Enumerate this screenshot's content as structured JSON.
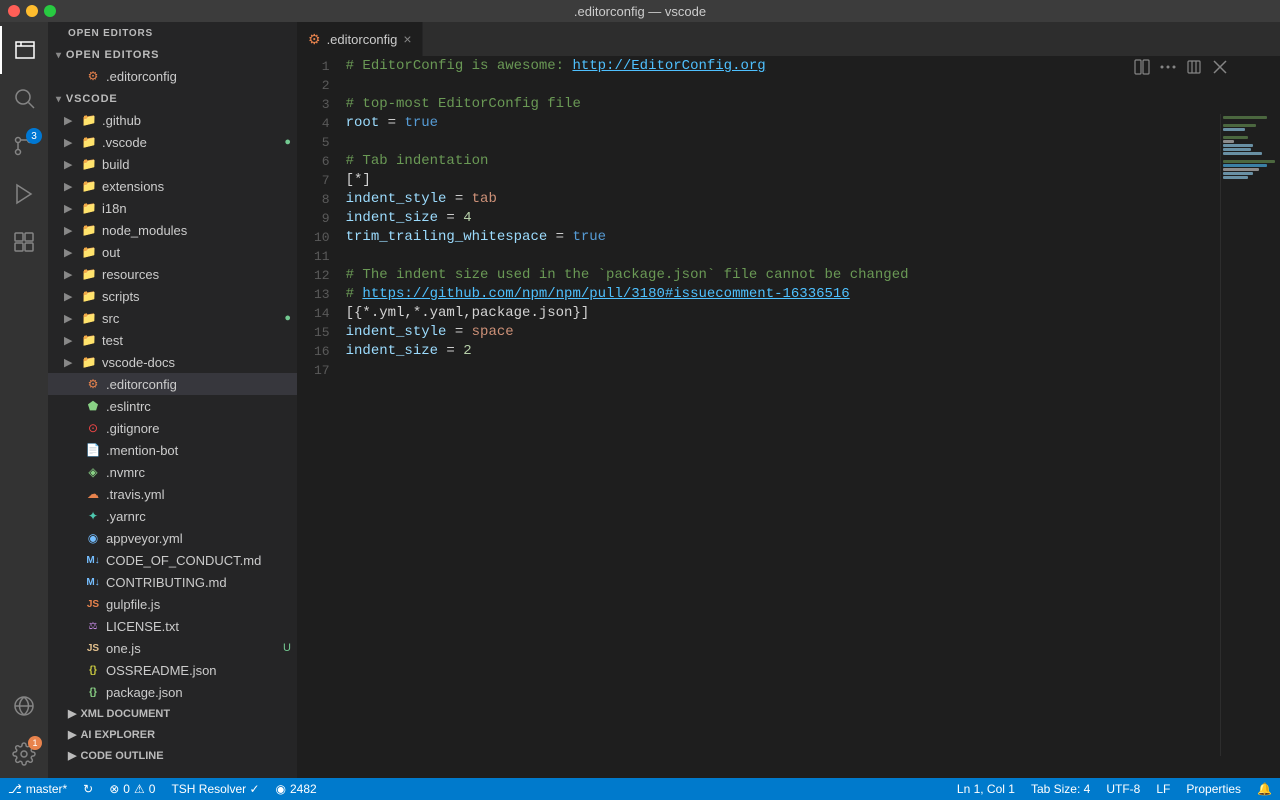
{
  "titlebar": {
    "title": ".editorconfig — vscode"
  },
  "activitybar": {
    "icons": [
      {
        "name": "explorer-icon",
        "label": "Explorer",
        "active": true,
        "unicode": "⎘",
        "badge": null
      },
      {
        "name": "search-icon",
        "label": "Search",
        "active": false,
        "unicode": "🔍",
        "badge": null
      },
      {
        "name": "git-icon",
        "label": "Source Control",
        "active": false,
        "unicode": "⑂",
        "badge": "3"
      },
      {
        "name": "debug-icon",
        "label": "Run and Debug",
        "active": false,
        "unicode": "▷",
        "badge": null
      },
      {
        "name": "extensions-icon",
        "label": "Extensions",
        "active": false,
        "unicode": "⊞",
        "badge": null
      }
    ],
    "bottomIcons": [
      {
        "name": "remote-icon",
        "label": "Remote",
        "unicode": "⊗"
      },
      {
        "name": "gear-icon",
        "label": "Settings",
        "unicode": "⚙",
        "badge": "1"
      }
    ]
  },
  "sidebar": {
    "sections": {
      "openEditors": {
        "label": "OPEN EDITORS",
        "items": [
          {
            "name": ".editorconfig",
            "icon": "editorconfig",
            "color": "icon-orange"
          }
        ]
      },
      "vscode": {
        "label": "VSCODE",
        "folders": [
          {
            "name": ".github",
            "indent": 1,
            "expanded": false,
            "icon": "folder"
          },
          {
            "name": ".vscode",
            "indent": 1,
            "expanded": false,
            "icon": "folder-blue",
            "badge": "green"
          },
          {
            "name": "build",
            "indent": 1,
            "expanded": false,
            "icon": "folder-orange"
          },
          {
            "name": "extensions",
            "indent": 1,
            "expanded": false,
            "icon": "folder-orange"
          },
          {
            "name": "i18n",
            "indent": 1,
            "expanded": false,
            "icon": "folder-orange"
          },
          {
            "name": "node_modules",
            "indent": 1,
            "expanded": false,
            "icon": "folder-orange"
          },
          {
            "name": "out",
            "indent": 1,
            "expanded": false,
            "icon": "folder-orange"
          },
          {
            "name": "resources",
            "indent": 1,
            "expanded": false,
            "icon": "folder-orange"
          },
          {
            "name": "scripts",
            "indent": 1,
            "expanded": false,
            "icon": "folder-orange"
          },
          {
            "name": "src",
            "indent": 1,
            "expanded": false,
            "icon": "folder-blue",
            "badge": "green"
          },
          {
            "name": "test",
            "indent": 1,
            "expanded": false,
            "icon": "folder-orange"
          },
          {
            "name": "vscode-docs",
            "indent": 1,
            "expanded": false,
            "icon": "folder-orange"
          },
          {
            "name": ".editorconfig",
            "indent": 1,
            "expanded": false,
            "icon": "file-editorconfig",
            "selected": true
          },
          {
            "name": ".eslintrc",
            "indent": 1,
            "expanded": false,
            "icon": "file-eslint"
          },
          {
            "name": ".gitignore",
            "indent": 1,
            "expanded": false,
            "icon": "file-gitignore"
          },
          {
            "name": ".mention-bot",
            "indent": 1,
            "expanded": false,
            "icon": "file-white"
          },
          {
            "name": ".nvmrc",
            "indent": 1,
            "expanded": false,
            "icon": "file-white"
          },
          {
            "name": ".travis.yml",
            "indent": 1,
            "expanded": false,
            "icon": "file-yaml"
          },
          {
            "name": ".yarnrc",
            "indent": 1,
            "expanded": false,
            "icon": "file-white"
          },
          {
            "name": "appveyor.yml",
            "indent": 1,
            "expanded": false,
            "icon": "file-yaml-blue"
          },
          {
            "name": "CODE_OF_CONDUCT.md",
            "indent": 1,
            "expanded": false,
            "icon": "file-md"
          },
          {
            "name": "CONTRIBUTING.md",
            "indent": 1,
            "expanded": false,
            "icon": "file-md"
          },
          {
            "name": "gulpfile.js",
            "indent": 1,
            "expanded": false,
            "icon": "file-js"
          },
          {
            "name": "LICENSE.txt",
            "indent": 1,
            "expanded": false,
            "icon": "file-license"
          },
          {
            "name": "one.js",
            "indent": 1,
            "expanded": false,
            "icon": "file-js-yellow",
            "badge": "U"
          },
          {
            "name": "OSSREADME.json",
            "indent": 1,
            "expanded": false,
            "icon": "file-json"
          },
          {
            "name": "package.json",
            "indent": 1,
            "expanded": false,
            "icon": "file-json-green"
          }
        ]
      },
      "xmlDocument": {
        "label": "XML DOCUMENT",
        "collapsed": true
      },
      "aiExplorer": {
        "label": "AI EXPLORER",
        "collapsed": true
      },
      "codeOutline": {
        "label": "CODE OUTLINE",
        "collapsed": true
      }
    }
  },
  "tabs": [
    {
      "label": ".editorconfig",
      "active": true,
      "icon": "⚙",
      "iconColor": "#e8834d"
    }
  ],
  "editor": {
    "filename": ".editorconfig",
    "lines": [
      {
        "num": 1,
        "tokens": [
          {
            "text": "# EditorConfig is awesome: ",
            "class": "c-comment"
          },
          {
            "text": "http://EditorConfig.org",
            "class": "c-link"
          }
        ]
      },
      {
        "num": 2,
        "tokens": []
      },
      {
        "num": 3,
        "tokens": [
          {
            "text": "# top-most EditorConfig file",
            "class": "c-comment"
          }
        ]
      },
      {
        "num": 4,
        "tokens": [
          {
            "text": "root",
            "class": "c-key"
          },
          {
            "text": " = ",
            "class": "c-eq"
          },
          {
            "text": "true",
            "class": "c-val-true"
          }
        ]
      },
      {
        "num": 5,
        "tokens": []
      },
      {
        "num": 6,
        "tokens": [
          {
            "text": "# Tab indentation",
            "class": "c-comment"
          }
        ]
      },
      {
        "num": 7,
        "tokens": [
          {
            "text": "[*]",
            "class": "c-section"
          }
        ]
      },
      {
        "num": 8,
        "tokens": [
          {
            "text": "indent_style",
            "class": "c-key"
          },
          {
            "text": " = ",
            "class": "c-eq"
          },
          {
            "text": "tab",
            "class": "c-val-str"
          }
        ]
      },
      {
        "num": 9,
        "tokens": [
          {
            "text": "indent_size",
            "class": "c-key"
          },
          {
            "text": " = ",
            "class": "c-eq"
          },
          {
            "text": "4",
            "class": "c-val-num"
          }
        ]
      },
      {
        "num": 10,
        "tokens": [
          {
            "text": "trim_trailing_whitespace",
            "class": "c-key"
          },
          {
            "text": " = ",
            "class": "c-eq"
          },
          {
            "text": "true",
            "class": "c-val-true"
          }
        ]
      },
      {
        "num": 11,
        "tokens": []
      },
      {
        "num": 12,
        "tokens": [
          {
            "text": "# The indent size used in the `package.json` file cannot be changed",
            "class": "c-comment"
          }
        ]
      },
      {
        "num": 13,
        "tokens": [
          {
            "text": "# ",
            "class": "c-comment"
          },
          {
            "text": "https://github.com/npm/npm/pull/3180#issuecomment-16336516",
            "class": "c-link"
          }
        ]
      },
      {
        "num": 14,
        "tokens": [
          {
            "text": "[{*.yml,*.yaml,package.json}]",
            "class": "c-section"
          }
        ]
      },
      {
        "num": 15,
        "tokens": [
          {
            "text": "indent_style",
            "class": "c-key"
          },
          {
            "text": " = ",
            "class": "c-eq"
          },
          {
            "text": "space",
            "class": "c-val-str"
          }
        ]
      },
      {
        "num": 16,
        "tokens": [
          {
            "text": "indent_size",
            "class": "c-key"
          },
          {
            "text": " = ",
            "class": "c-eq"
          },
          {
            "text": "2",
            "class": "c-val-num"
          }
        ]
      },
      {
        "num": 17,
        "tokens": []
      }
    ]
  },
  "statusbar": {
    "left": [
      {
        "icon": "⎇",
        "text": "master*"
      },
      {
        "icon": "↻",
        "text": ""
      },
      {
        "icon": "⊗",
        "text": "0"
      },
      {
        "icon": "⚠",
        "text": "0"
      },
      {
        "text": "TSH Resolver ✓"
      },
      {
        "icon": "👁",
        "text": "2482"
      }
    ],
    "right": [
      {
        "text": "Ln 1, Col 1"
      },
      {
        "text": "Tab Size: 4"
      },
      {
        "text": "UTF-8"
      },
      {
        "text": "LF"
      },
      {
        "text": "Properties"
      },
      {
        "icon": "🔔",
        "text": ""
      }
    ]
  }
}
